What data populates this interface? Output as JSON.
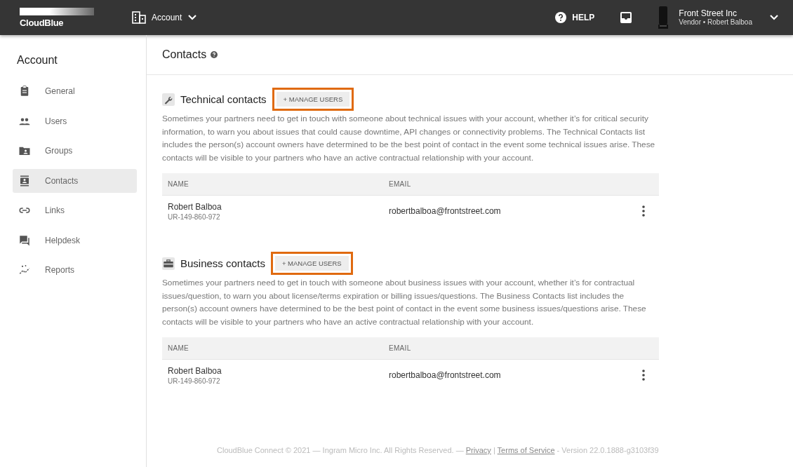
{
  "header": {
    "logo": "CloudBlue",
    "section": "Account",
    "help": "HELP",
    "account_name": "Front Street Inc",
    "account_sub": "Vendor • Robert Balboa"
  },
  "sidebar": {
    "title": "Account",
    "items": [
      {
        "label": "General",
        "selected": false
      },
      {
        "label": "Users",
        "selected": false
      },
      {
        "label": "Groups",
        "selected": false
      },
      {
        "label": "Contacts",
        "selected": true
      },
      {
        "label": "Links",
        "selected": false
      },
      {
        "label": "Helpdesk",
        "selected": false
      },
      {
        "label": "Reports",
        "selected": false
      }
    ]
  },
  "page": {
    "title": "Contacts"
  },
  "sections": [
    {
      "title": "Technical contacts",
      "button": "+ MANAGE USERS",
      "highlighted": true,
      "description": "Sometimes your partners need to get in touch with someone about technical issues with your account, whether it’s for critical security information, to warn you about issues that could cause downtime, API changes or connectivity problems. The Technical Contacts list includes the person(s) account owners have determined to be the best point of contact in the event some technical issues arise. These contacts will be visible to your partners who have an active contractual relationship with your account.",
      "columns": [
        "NAME",
        "EMAIL"
      ],
      "rows": [
        {
          "name": "Robert Balboa",
          "id": "UR-149-860-972",
          "email": "robertbalboa@frontstreet.com"
        }
      ]
    },
    {
      "title": "Business contacts",
      "button": "+ MANAGE USERS",
      "highlighted": true,
      "description": "Sometimes your partners need to get in touch with someone about business issues with your account, whether it’s for contractual issues/question, to warn you about license/terms expiration or billing issues/questions. The Business Contacts list includes the person(s) account owners have determined to be the best point of contact in the event some business issues/questions arise. These contacts will be visible to your partners who have an active contractual relationship with your account.",
      "columns": [
        "NAME",
        "EMAIL"
      ],
      "rows": [
        {
          "name": "Robert Balboa",
          "id": "UR-149-860-972",
          "email": "robertbalboa@frontstreet.com"
        }
      ]
    }
  ],
  "footer": {
    "copyright": "CloudBlue Connect © 2021 — Ingram Micro Inc. All Rights Reserved. —",
    "privacy": "Privacy",
    "separator": "|",
    "terms": "Terms of Service",
    "version": "- Version 22.0.1888-g3103f39"
  }
}
